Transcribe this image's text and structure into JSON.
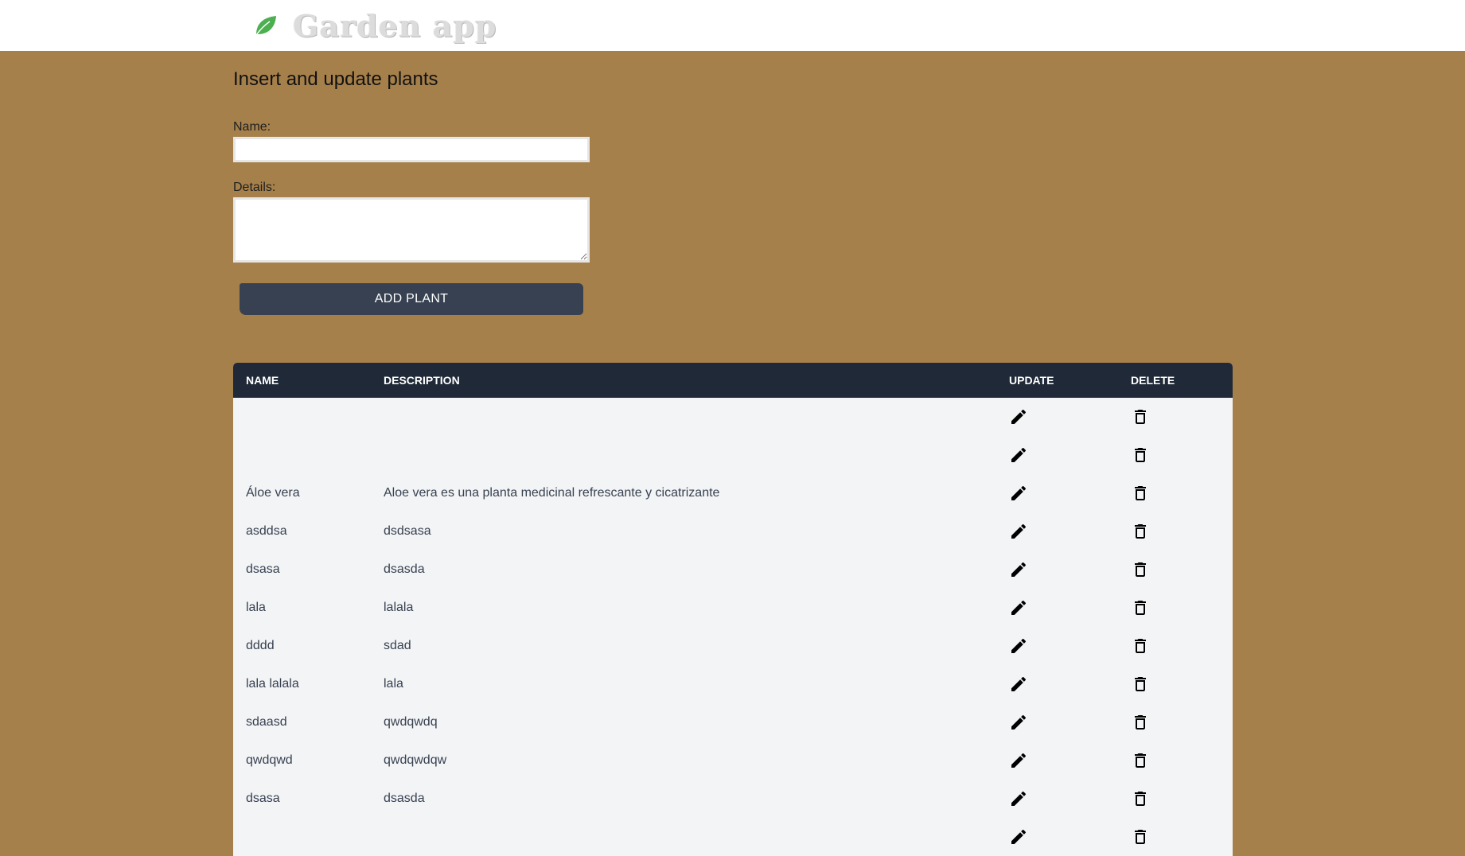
{
  "app": {
    "title": "Garden app",
    "logo_icon": "leaf-icon",
    "logo_color": "#4caf50"
  },
  "form": {
    "heading": "Insert and update plants",
    "name_label": "Name:",
    "name_value": "",
    "details_label": "Details:",
    "details_value": "",
    "submit_label": "ADD PLANT"
  },
  "table": {
    "headers": {
      "name": "NAME",
      "description": "DESCRIPTION",
      "update": "UPDATE",
      "delete": "DELETE"
    },
    "update_icon": "pencil-icon",
    "delete_icon": "trash-icon",
    "rows": [
      {
        "name": "",
        "description": ""
      },
      {
        "name": "",
        "description": ""
      },
      {
        "name": "Áloe vera",
        "description": "Aloe vera es una planta medicinal refrescante y cicatrizante"
      },
      {
        "name": "asddsa",
        "description": "dsdsasa"
      },
      {
        "name": "dsasa",
        "description": "dsasda"
      },
      {
        "name": "lala",
        "description": "lalala"
      },
      {
        "name": "dddd",
        "description": "sdad"
      },
      {
        "name": "lala lalala",
        "description": "lala"
      },
      {
        "name": "sdaasd",
        "description": "qwdqwdq"
      },
      {
        "name": "qwdqwd",
        "description": "qwdqwdqw"
      },
      {
        "name": "dsasa",
        "description": "dsasda"
      },
      {
        "name": "",
        "description": ""
      }
    ]
  },
  "colors": {
    "background": "#a6804b",
    "header_bar": "#1f2937",
    "button": "#374151",
    "table_body": "#f3f4f6"
  }
}
